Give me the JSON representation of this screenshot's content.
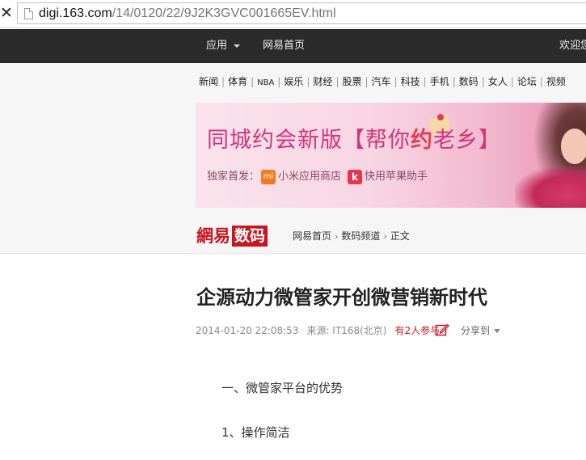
{
  "browser": {
    "close_glyph": "✕",
    "url_host": "digi.163.com",
    "url_path": "/14/0120/22/9J2K3GVC001665EV.html"
  },
  "topnav": {
    "apps_label": "应用",
    "home_label": "网易首页",
    "welcome_label": "欢迎您"
  },
  "channels": [
    "新闻",
    "体育",
    "NBA",
    "娱乐",
    "财经",
    "股票",
    "汽车",
    "科技",
    "手机",
    "数码",
    "女人",
    "论坛",
    "视频"
  ],
  "banner": {
    "title_part1": "同城约会新版【帮你",
    "title_yue": "约",
    "title_part2": "老乡】",
    "sub_prefix": "独家首发：",
    "mi_store": "小米应用商店",
    "k_helper": "快用苹果助手",
    "mi_icon": "mi",
    "k_icon": "k"
  },
  "logo": {
    "part1": "網易",
    "part2": "数码"
  },
  "breadcrumb": {
    "home": "网易首页",
    "channel": "数码频道",
    "current": "正文",
    "separator": "›"
  },
  "article": {
    "title": "企源动力微管家开创微营销新时代",
    "date": "2014-01-20 22:08:53",
    "source": "来源: IT168(北京)",
    "participants": "有2人参与",
    "share_label": "分享到",
    "paragraphs": [
      "一、微管家平台的优势",
      "1、操作简洁"
    ]
  },
  "colors": {
    "brand_red": "#c8161d",
    "topnav_bg": "#2b2b2b",
    "banner_pink": "#d4327a"
  }
}
